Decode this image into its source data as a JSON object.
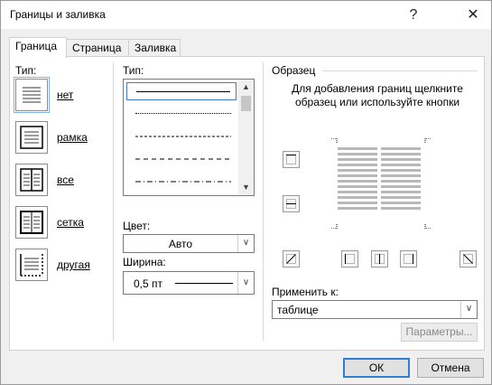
{
  "window": {
    "title": "Границы и заливка",
    "help_glyph": "?",
    "close_glyph": "✕"
  },
  "tabs": [
    {
      "label": "Граница",
      "active": true
    },
    {
      "label": "Страница",
      "active": false
    },
    {
      "label": "Заливка",
      "active": false
    }
  ],
  "settings": {
    "label": "Тип:",
    "items": [
      {
        "label": "нет",
        "icon": "border-none-icon",
        "selected": true
      },
      {
        "label": "рамка",
        "icon": "border-box-icon",
        "selected": false
      },
      {
        "label": "все",
        "icon": "border-all-icon",
        "selected": false
      },
      {
        "label": "сетка",
        "icon": "border-grid-icon",
        "selected": false
      },
      {
        "label": "другая",
        "icon": "border-custom-icon",
        "selected": false
      }
    ]
  },
  "style": {
    "label": "Тип:",
    "options": [
      "solid",
      "dotted",
      "dashed",
      "long-dashed",
      "dash-dot"
    ],
    "selected": "solid"
  },
  "color": {
    "label": "Цвет:",
    "value": "Авто"
  },
  "width": {
    "label": "Ширина:",
    "value": "0,5 пт"
  },
  "preview": {
    "label": "Образец",
    "hint": "Для добавления границ щелкните образец или используйте кнопки"
  },
  "apply_to": {
    "label": "Применить к:",
    "value": "таблице"
  },
  "buttons": {
    "options": "Параметры...",
    "ok": "ОК",
    "cancel": "Отмена"
  }
}
